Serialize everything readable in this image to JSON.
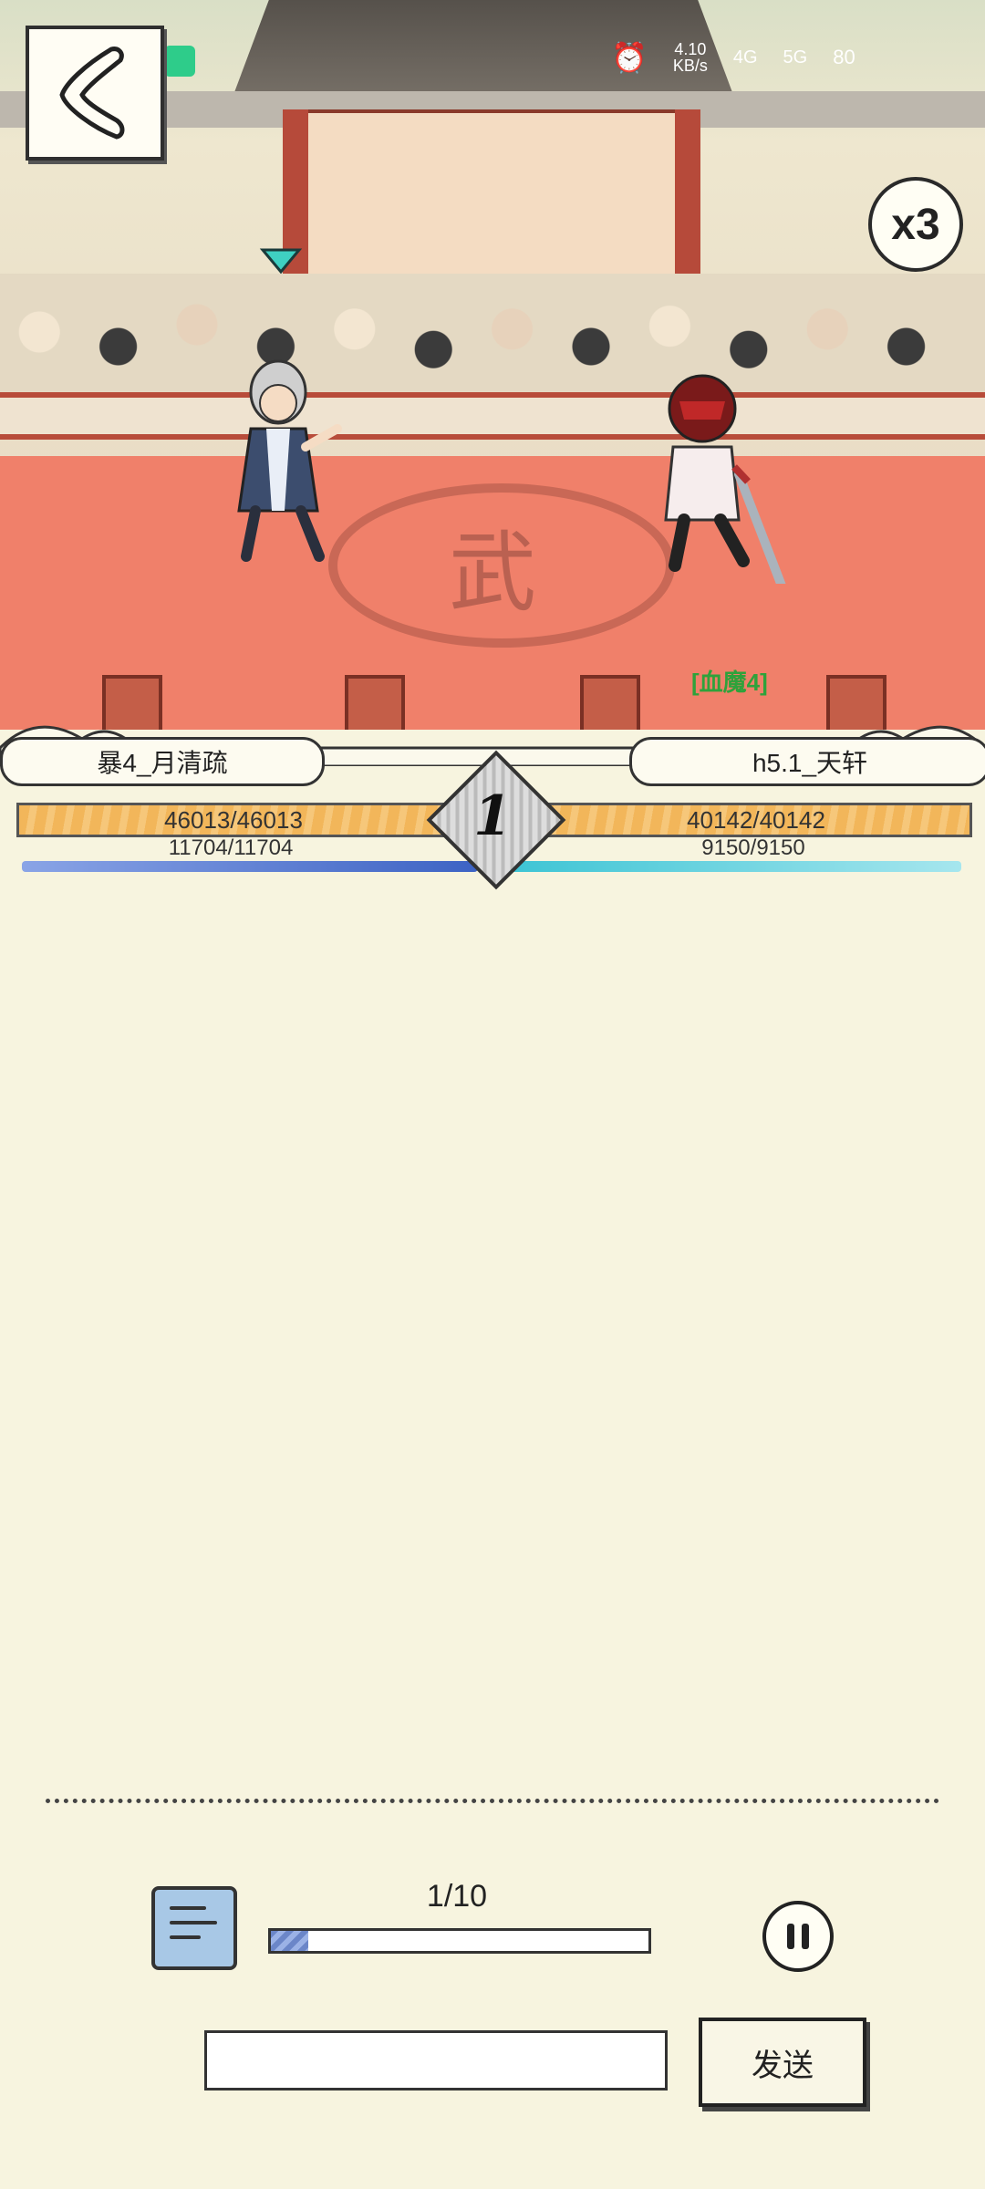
{
  "status_bar": {
    "network_speed": "4.10",
    "speed_unit": "KB/s",
    "net1": "4G",
    "net2": "5G",
    "battery": "80"
  },
  "arena": {
    "emblem_char": "武",
    "speed_multiplier": "x3",
    "buff_label": "[血魔4]"
  },
  "player_left": {
    "name": "暴4_月清疏",
    "hp": "46013/46013",
    "mp": "11704/11704",
    "hp_ratio": 1.0,
    "mp_ratio": 1.0
  },
  "player_right": {
    "name": "h5.1_天轩",
    "hp": "40142/40142",
    "mp": "9150/9150",
    "hp_ratio": 1.0,
    "mp_ratio": 1.0
  },
  "round": {
    "number": "1"
  },
  "progress": {
    "label": "1/10",
    "fraction": 0.1
  },
  "chat": {
    "input_value": "",
    "send_label": "发送"
  },
  "colors": {
    "floor": "#f0806a",
    "hp": "#f2b65a",
    "mp_left": "#3d63c4",
    "mp_right": "#3cc4d4",
    "parchment": "#f7f4df"
  }
}
